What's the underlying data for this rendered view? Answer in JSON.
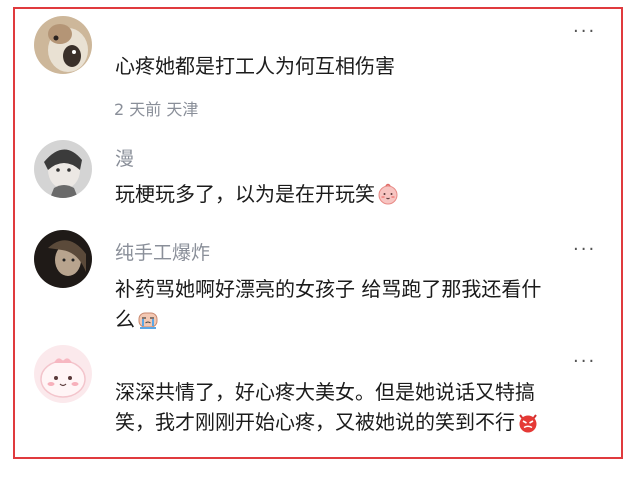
{
  "comments": [
    {
      "username": "",
      "lines": [
        "心疼她都是打工人为何互相伤害"
      ],
      "meta": "2 天前 天津",
      "more": "···"
    },
    {
      "username": "漫",
      "lines": [
        "玩梗玩多了，以为是在开玩笑"
      ],
      "more": ""
    },
    {
      "username": "纯手工爆炸",
      "lines": [
        "补药骂她啊好漂亮的女孩子 给骂跑了那我还看什",
        "么"
      ],
      "more": "···"
    },
    {
      "username": "",
      "lines": [
        "深深共情了，好心疼大美女。但是她说话又特搞",
        "笑，我才刚刚开始心疼，又被她说的笑到不行"
      ],
      "more": "···"
    }
  ],
  "colors": {
    "frame_border": "#e03a3e",
    "username": "#8a8f99",
    "body_text": "#1b1b1b"
  },
  "icons": {
    "c2_emoji": "blush-face-icon",
    "c3_emoji": "crying-face-icon",
    "c4_emoji": "angry-devil-icon"
  }
}
